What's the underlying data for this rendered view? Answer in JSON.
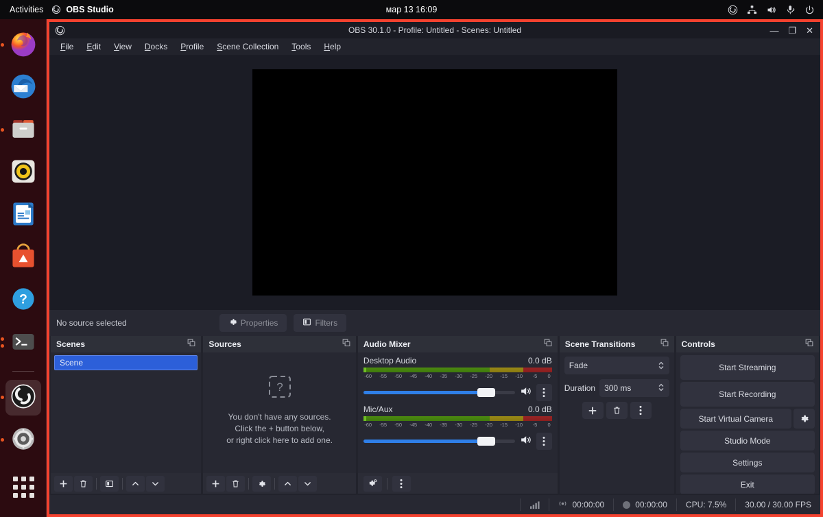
{
  "gnome": {
    "activities": "Activities",
    "app_name": "OBS Studio",
    "clock": "мар 13  16:09",
    "tray_icons": [
      "obs-tray-icon",
      "network-icon",
      "volume-icon",
      "microphone-icon",
      "power-icon"
    ]
  },
  "dock": {
    "items": [
      {
        "name": "firefox",
        "label": "Firefox"
      },
      {
        "name": "thunderbird",
        "label": "Thunderbird Mail"
      },
      {
        "name": "files",
        "label": "Files"
      },
      {
        "name": "rhythmbox",
        "label": "Rhythmbox"
      },
      {
        "name": "libreoffice-writer",
        "label": "LibreOffice Writer"
      },
      {
        "name": "ubuntu-software",
        "label": "Ubuntu Software"
      },
      {
        "name": "help",
        "label": "Help"
      },
      {
        "name": "terminal",
        "label": "Terminal"
      },
      {
        "name": "obs-studio",
        "label": "OBS Studio"
      },
      {
        "name": "settings",
        "label": "Settings"
      },
      {
        "name": "show-applications",
        "label": "Show Applications"
      }
    ]
  },
  "window": {
    "title": "OBS 30.1.0 - Profile: Untitled - Scenes: Untitled",
    "minimize": "—",
    "maximize": "❐",
    "close": "✕",
    "border_color": "#f4422f"
  },
  "menubar": [
    {
      "pre": "",
      "key": "F",
      "post": "ile"
    },
    {
      "pre": "",
      "key": "E",
      "post": "dit"
    },
    {
      "pre": "",
      "key": "V",
      "post": "iew"
    },
    {
      "pre": "",
      "key": "D",
      "post": "ocks"
    },
    {
      "pre": "",
      "key": "P",
      "post": "rofile"
    },
    {
      "pre": "",
      "key": "S",
      "post": "cene Collection"
    },
    {
      "pre": "",
      "key": "T",
      "post": "ools"
    },
    {
      "pre": "",
      "key": "H",
      "post": "elp"
    }
  ],
  "source_toolbar": {
    "status": "No source selected",
    "properties": "Properties",
    "filters": "Filters"
  },
  "scenes": {
    "title": "Scenes",
    "items": [
      {
        "label": "Scene",
        "selected": true
      }
    ],
    "toolbar": [
      "add-icon",
      "remove-icon",
      "filters-icon",
      "move-up-icon",
      "move-down-icon"
    ]
  },
  "sources": {
    "title": "Sources",
    "empty_line1": "You don't have any sources.",
    "empty_line2": "Click the + button below,",
    "empty_line3": "or right click here to add one.",
    "toolbar": [
      "add-icon",
      "remove-icon",
      "properties-icon",
      "move-up-icon",
      "move-down-icon"
    ]
  },
  "mixer": {
    "title": "Audio Mixer",
    "scale_ticks": [
      "-60",
      "-55",
      "-50",
      "-45",
      "-40",
      "-35",
      "-30",
      "-25",
      "-20",
      "-15",
      "-10",
      "-5",
      "0"
    ],
    "tracks": [
      {
        "name": "Desktop Audio",
        "db": "0.0 dB",
        "volume_pct": 81
      },
      {
        "name": "Mic/Aux",
        "db": "0.0 dB",
        "volume_pct": 81
      }
    ]
  },
  "transitions": {
    "title": "Scene Transitions",
    "transition": "Fade",
    "duration_label": "Duration",
    "duration_value": "300 ms"
  },
  "controls": {
    "title": "Controls",
    "start_streaming": "Start Streaming",
    "start_recording": "Start Recording",
    "start_virtual_camera": "Start Virtual Camera",
    "studio_mode": "Studio Mode",
    "settings": "Settings",
    "exit": "Exit"
  },
  "statusbar": {
    "stream_time": "00:00:00",
    "record_time": "00:00:00",
    "cpu": "CPU: 7.5%",
    "fps": "30.00 / 30.00 FPS"
  }
}
